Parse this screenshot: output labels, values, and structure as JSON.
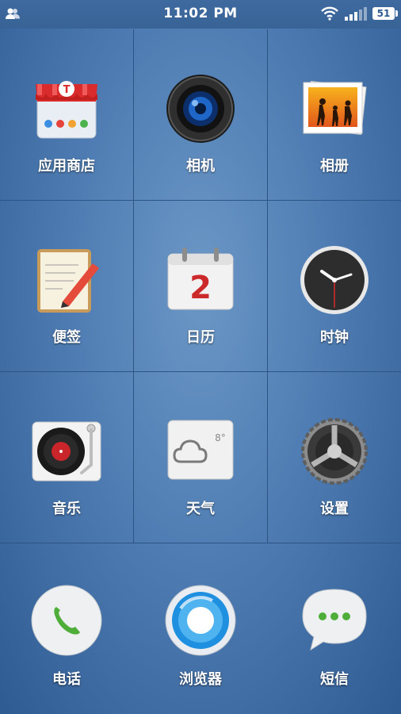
{
  "status_bar": {
    "time": "11:02 PM",
    "battery": "51",
    "icons": [
      "user-icon",
      "wifi-icon",
      "signal-icon",
      "battery-icon"
    ]
  },
  "apps": [
    {
      "label": "应用商店",
      "icon": "app-store-icon"
    },
    {
      "label": "相机",
      "icon": "camera-icon"
    },
    {
      "label": "相册",
      "icon": "gallery-icon"
    },
    {
      "label": "便签",
      "icon": "notes-icon"
    },
    {
      "label": "日历",
      "icon": "calendar-icon",
      "calendar_day": "2"
    },
    {
      "label": "时钟",
      "icon": "clock-icon"
    },
    {
      "label": "音乐",
      "icon": "music-icon"
    },
    {
      "label": "天气",
      "icon": "weather-icon",
      "temperature": "8°"
    },
    {
      "label": "设置",
      "icon": "settings-icon"
    }
  ],
  "dock": [
    {
      "label": "电话",
      "icon": "phone-icon"
    },
    {
      "label": "浏览器",
      "icon": "browser-icon"
    },
    {
      "label": "短信",
      "icon": "messages-icon"
    }
  ],
  "colors": {
    "background": "#4f7db3",
    "status_bar": "#3a6599",
    "grid_lines": "#2c5586",
    "label_text": "#ffffff"
  }
}
